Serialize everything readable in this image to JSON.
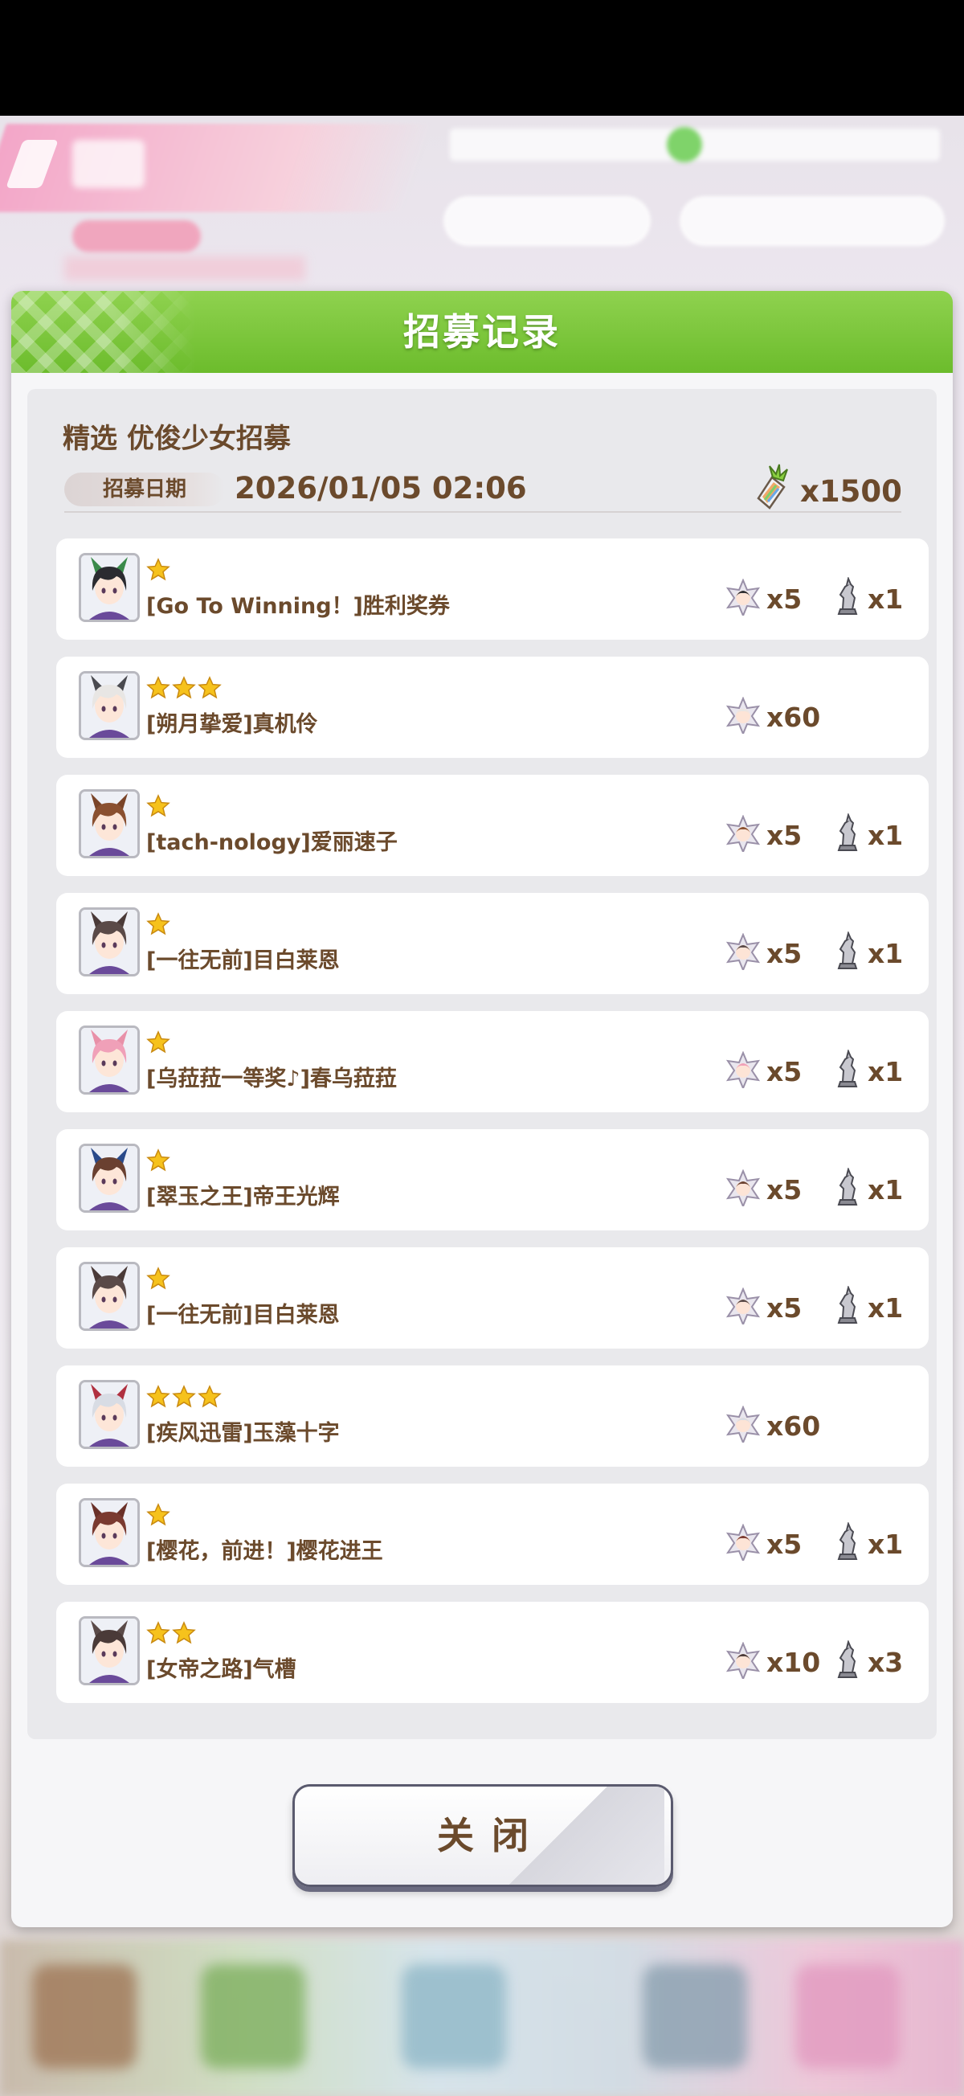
{
  "dialog": {
    "title": "招募记录",
    "banner_name": "精选 优俊少女招募",
    "date_label": "招募日期",
    "date_value": "2026/01/05 02:06",
    "cost_icon": "carrot-ticket-icon",
    "cost_value": "x1500",
    "close_label": "关闭"
  },
  "results": [
    {
      "stars": 1,
      "name": "[Go To Winning！]胜利奖券",
      "piece": "x5",
      "statue": "x1",
      "hair": "#2b2b30",
      "ear": "#3a8a4a"
    },
    {
      "stars": 3,
      "name": "[朔月挚爱]真机伶",
      "piece": "x60",
      "statue": "",
      "hair": "#e8e6e4",
      "ear": "#4a4a50"
    },
    {
      "stars": 1,
      "name": "[tach-nology]爱丽速子",
      "piece": "x5",
      "statue": "x1",
      "hair": "#8a5030",
      "ear": "#7a4428"
    },
    {
      "stars": 1,
      "name": "[一往无前]目白莱恩",
      "piece": "x5",
      "statue": "x1",
      "hair": "#5a4a48",
      "ear": "#4a3a38"
    },
    {
      "stars": 1,
      "name": "[乌菈菈一等奖♪]春乌菈菈",
      "piece": "x5",
      "statue": "x1",
      "hair": "#f0a0b8",
      "ear": "#e890a8"
    },
    {
      "stars": 1,
      "name": "[翠玉之王]帝王光辉",
      "piece": "x5",
      "statue": "x1",
      "hair": "#6a4030",
      "ear": "#2a4a8a"
    },
    {
      "stars": 1,
      "name": "[一往无前]目白莱恩",
      "piece": "x5",
      "statue": "x1",
      "hair": "#5a4a48",
      "ear": "#4a3a38"
    },
    {
      "stars": 3,
      "name": "[疾风迅雷]玉藻十字",
      "piece": "x60",
      "statue": "",
      "hair": "#d8dce4",
      "ear": "#b03040"
    },
    {
      "stars": 1,
      "name": "[樱花，前进！]樱花进王",
      "piece": "x5",
      "statue": "x1",
      "hair": "#7a3a30",
      "ear": "#6a3028"
    },
    {
      "stars": 2,
      "name": "[女帝之路]气槽",
      "piece": "x10",
      "statue": "x3",
      "hair": "#4a3a38",
      "ear": "#5a4a48"
    }
  ],
  "colors": {
    "header_green": "#7cc83a",
    "text_brown": "#6b4a2c",
    "star_gold": "#f6c21c"
  }
}
